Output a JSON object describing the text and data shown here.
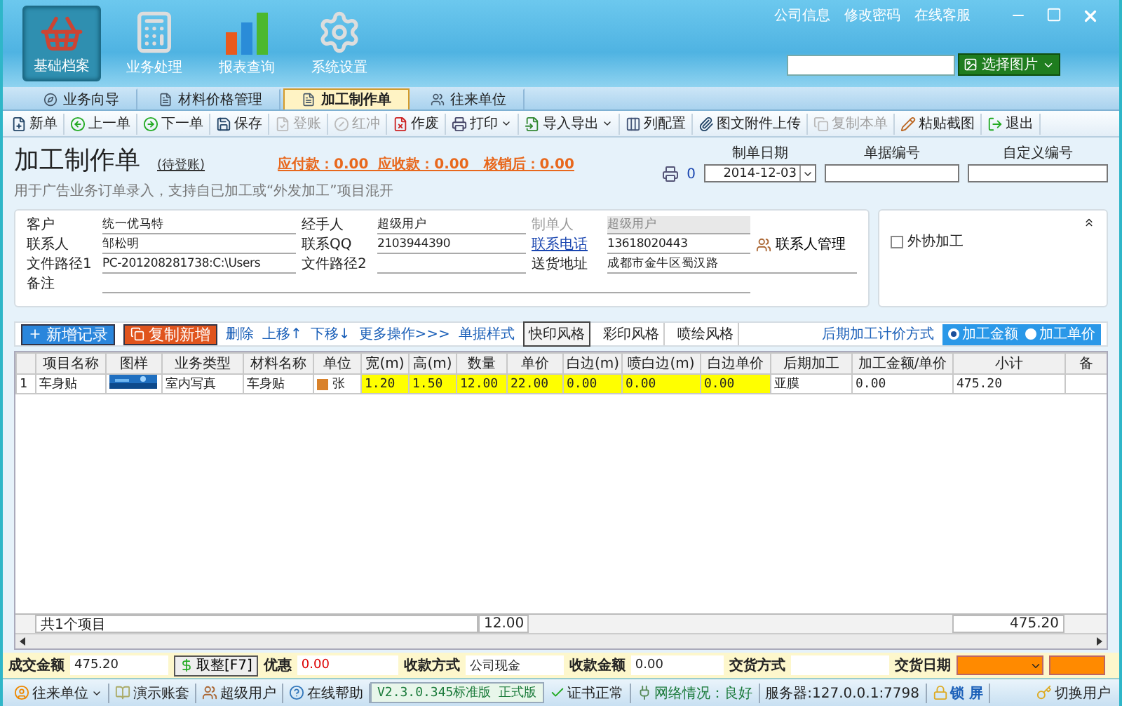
{
  "header": {
    "nav": [
      {
        "label": "基础档案",
        "selected": true
      },
      {
        "label": "业务处理",
        "selected": false
      },
      {
        "label": "报表查询",
        "selected": false
      },
      {
        "label": "系统设置",
        "selected": false
      }
    ],
    "links": [
      "公司信息",
      "修改密码",
      "在线客服"
    ],
    "image_button": "选择图片"
  },
  "tabs": [
    {
      "label": "业务向导",
      "selected": false
    },
    {
      "label": "材料价格管理",
      "selected": false
    },
    {
      "label": "加工制作单",
      "selected": true
    },
    {
      "label": "往来单位",
      "selected": false
    }
  ],
  "toolbar": [
    {
      "label": "新单",
      "disabled": false,
      "dropdown": false
    },
    {
      "label": "上一单",
      "disabled": false,
      "dropdown": false
    },
    {
      "label": "下一单",
      "disabled": false,
      "dropdown": false
    },
    {
      "label": "保存",
      "disabled": false,
      "dropdown": false
    },
    {
      "label": "登账",
      "disabled": true,
      "dropdown": false
    },
    {
      "label": "红冲",
      "disabled": true,
      "dropdown": false
    },
    {
      "label": "作废",
      "disabled": false,
      "dropdown": false
    },
    {
      "label": "打印",
      "disabled": false,
      "dropdown": true
    },
    {
      "label": "导入导出",
      "disabled": false,
      "dropdown": true
    },
    {
      "label": "列配置",
      "disabled": false,
      "dropdown": false
    },
    {
      "label": "图文附件上传",
      "disabled": false,
      "dropdown": false
    },
    {
      "label": "复制本单",
      "disabled": true,
      "dropdown": false
    },
    {
      "label": "粘贴截图",
      "disabled": false,
      "dropdown": false
    },
    {
      "label": "退出",
      "disabled": false,
      "dropdown": false
    }
  ],
  "form": {
    "title": "加工制作单",
    "status": "(待登账)",
    "totals": "应付款：0.00  应收款：0.00   核销后：0.00",
    "subtitle": "用于广告业务订单录入，支持自已加工或“外发加工”项目混开",
    "print_count": "0",
    "date_label": "制单日期",
    "date": "2014-12-03",
    "number_label": "单据编号",
    "custom_label": "自定义编号"
  },
  "fields": [
    {
      "label": "客户",
      "value": "统一优马特",
      "kind": "text"
    },
    {
      "label": "经手人",
      "value": "超级用户",
      "kind": "text"
    },
    {
      "label": "制单人",
      "value": "超级用户",
      "kind": "readonly"
    },
    {
      "label": "联系人",
      "value": "邹松明",
      "kind": "text"
    },
    {
      "label": "联系QQ",
      "value": "2103944390",
      "kind": "text"
    },
    {
      "label": "联系电话",
      "value": "13618020443",
      "kind": "link"
    },
    {
      "label": "文件路径1",
      "value": "PC-201208281738:C:\\Users",
      "kind": "text"
    },
    {
      "label": "文件路径2",
      "kind": "text"
    },
    {
      "label": "送货地址",
      "value": "成都市金牛区蜀汉路",
      "kind": "wide"
    },
    {
      "label": "备注",
      "kind": "note"
    }
  ],
  "contact_button": "联系人管理",
  "outsource": {
    "label": "外协加工",
    "checked": false
  },
  "items_toolbar": {
    "buttons": [
      {
        "label": "新增记录",
        "kind": "primary"
      },
      {
        "label": "复制新增",
        "kind": "secondary"
      }
    ],
    "links": [
      "删除",
      "上移↑",
      "下移↓",
      "更多操作>>>",
      "单据样式"
    ],
    "styles": [
      {
        "label": "快印风格",
        "selected": true
      },
      {
        "label": "彩印风格",
        "selected": false
      },
      {
        "label": "喷绘风格",
        "selected": false
      }
    ],
    "pricing_label": "后期加工计价方式",
    "pricing": [
      {
        "label": "加工金额",
        "selected": true
      },
      {
        "label": "加工单价",
        "selected": false
      }
    ]
  },
  "table": {
    "columns": [
      {
        "highlight": false
      },
      {
        "label": "项目名称",
        "highlight": false
      },
      {
        "label": "图样",
        "highlight": false
      },
      {
        "label": "业务类型",
        "highlight": false
      },
      {
        "label": "材料名称",
        "highlight": false
      },
      {
        "label": "单位",
        "highlight": false
      },
      {
        "label": "宽(m)",
        "highlight": true
      },
      {
        "label": "高(m)",
        "highlight": true
      },
      {
        "label": "数量",
        "highlight": true
      },
      {
        "label": "单价",
        "highlight": true
      },
      {
        "label": "白边(m)",
        "highlight": true
      },
      {
        "label": "喷白边(m)",
        "highlight": true
      },
      {
        "label": "白边单价",
        "highlight": true
      },
      {
        "label": "后期加工",
        "highlight": false
      },
      {
        "label": "加工金额/单价",
        "highlight": false
      },
      {
        "label": "小计",
        "highlight": false
      },
      {
        "label": "备",
        "highlight": false
      }
    ],
    "rows": [
      [
        "1",
        "车身贴",
        {
          "kind": "picture"
        },
        "室内写真",
        "车身贴",
        "张",
        "1.20",
        "1.50",
        "12.00",
        "22.00",
        "0.00",
        "0.00",
        "0.00",
        "亚膜",
        "0.00",
        "475.20"
      ]
    ],
    "footer": {
      "count": "共1个项目",
      "quantity": "12.00",
      "total": "475.20"
    }
  },
  "summary": {
    "amount_label": "成交金额",
    "amount": "475.20",
    "round_button": "取整[F7]",
    "discount_label": "优惠",
    "discount": "0.00",
    "payment_label": "收款方式",
    "payment": "公司现金",
    "received_label": "收款金额",
    "received": "0.00",
    "delivery_label": "交货方式",
    "delivery_date_label": "交货日期"
  },
  "status_bar": {
    "items": [
      {
        "label": "往来单位",
        "kind": "menu"
      },
      {
        "label": "演示账套",
        "kind": "item"
      },
      {
        "label": "超级用户",
        "kind": "item"
      },
      {
        "label": "在线帮助",
        "kind": "item"
      },
      {
        "label": "V2.3.0.345标准版 正式版",
        "kind": "version"
      },
      {
        "label": "证书正常",
        "kind": "ok"
      },
      {
        "label": "网络情况：良好",
        "kind": "network"
      },
      {
        "label": "服务器:127.0.0.1:7798",
        "kind": "text"
      },
      {
        "label": "锁 屏",
        "kind": "lock"
      }
    ],
    "switch_user": "切换用户"
  }
}
